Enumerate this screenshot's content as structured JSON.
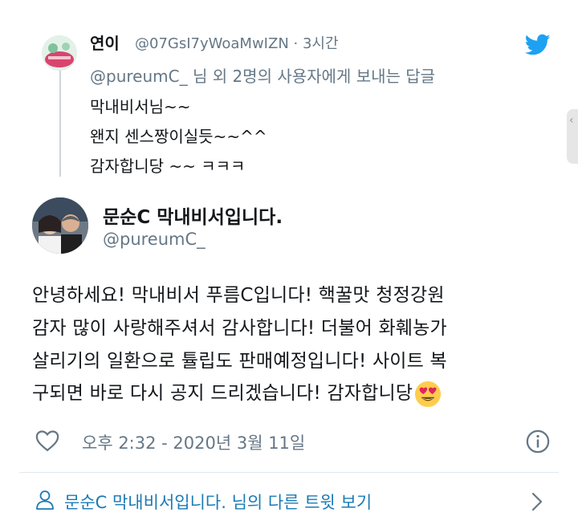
{
  "reply_tweet": {
    "display_name": "연이",
    "handle_and_time": "@07GsI7yWoaMwIZN · 3시간",
    "reply_to": "@pureumC_ 님 외 2명의 사용자에게 보내는 답글",
    "lines": [
      "막내비서님~~",
      "왠지 센스짱이실듯~~^^",
      "감자합니당 ~~ ㅋㅋㅋ"
    ]
  },
  "main_tweet": {
    "display_name": "문순C 막내비서입니다.",
    "handle": "@pureumC_",
    "body_lines": [
      "안녕하세요! 막내비서 푸름C입니다! 핵꿀맛 청정강원",
      "감자 많이 사랑해주셔서 감사합니다! 더불어 화훼농가",
      "살리기의 일환으로 튤립도 판매예정입니다! 사이트 복",
      "구되면 바로 다시 공지 드리겠습니다! 감자합니당"
    ],
    "emoji": "heart-eyes-emoji",
    "timestamp": "오후 2:32 - 2020년 3월 11일"
  },
  "footer": {
    "more_tweets_label": "문순C 막내비서입니다. 님의 다른 트윗 보기"
  },
  "colors": {
    "twitter_blue": "#1da1f2",
    "link_blue": "#1b7ab6",
    "secondary_text": "#657786",
    "divider": "#e1e8ed"
  },
  "icons": [
    "twitter-bird-icon",
    "heart-icon",
    "info-icon",
    "person-icon",
    "chevron-right-icon"
  ]
}
